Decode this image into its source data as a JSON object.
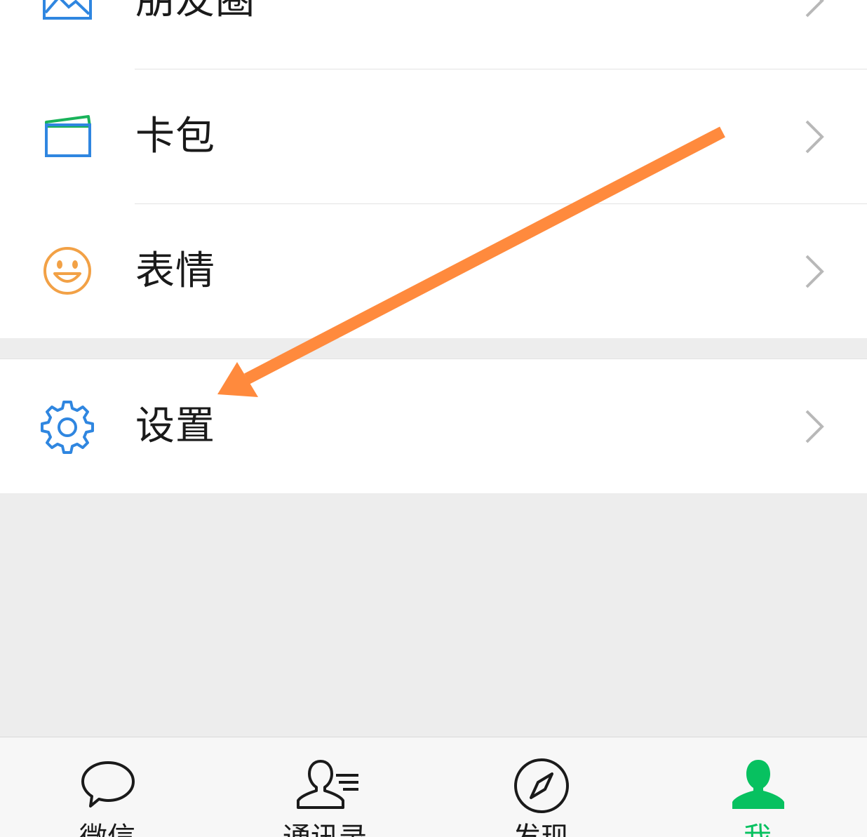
{
  "colors": {
    "accent_green": "#07c160",
    "icon_blue": "#2f86e0",
    "icon_orange": "#f2a146",
    "annotation_orange": "#ff8a3d",
    "text": "#1a1a1a",
    "chevron": "#b8b8b8"
  },
  "menu": {
    "items": [
      {
        "label": "朋友圈",
        "icon": "moments-icon"
      },
      {
        "label": "卡包",
        "icon": "card-wallet-icon"
      },
      {
        "label": "表情",
        "icon": "smiley-icon"
      }
    ],
    "settings": {
      "label": "设置",
      "icon": "gear-icon"
    }
  },
  "tabbar": {
    "tabs": [
      {
        "label": "微信",
        "icon": "chat-bubble-icon",
        "active": false
      },
      {
        "label": "通讯录",
        "icon": "contacts-icon",
        "active": false
      },
      {
        "label": "发现",
        "icon": "compass-icon",
        "active": false
      },
      {
        "label": "我",
        "icon": "person-icon",
        "active": true
      }
    ]
  },
  "annotation": {
    "type": "arrow",
    "points_to": "settings"
  }
}
